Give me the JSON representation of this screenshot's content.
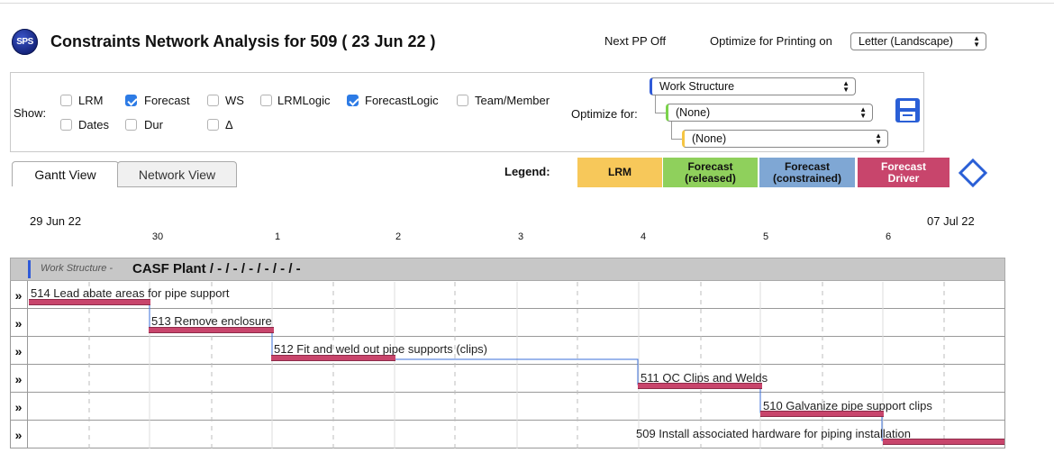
{
  "header": {
    "logo_text": "SPS",
    "title": "Constraints Network Analysis for 509 ( 23 Jun 22 )",
    "next_pp": "Next PP Off",
    "optimize_printing_label": "Optimize for Printing on",
    "print_option": "Letter (Landscape)"
  },
  "options": {
    "show_label": "Show:",
    "checkboxes": [
      {
        "label": "LRM",
        "checked": false
      },
      {
        "label": "Forecast",
        "checked": true
      },
      {
        "label": "WS",
        "checked": false
      },
      {
        "label": "LRMLogic",
        "checked": false
      },
      {
        "label": "ForecastLogic",
        "checked": true
      },
      {
        "label": "Team/Member",
        "checked": false
      },
      {
        "label": "Dates",
        "checked": false
      },
      {
        "label": "Dur",
        "checked": false
      },
      {
        "label": "Δ",
        "checked": false
      }
    ],
    "optimize_for_label": "Optimize for:",
    "level1": "Work Structure",
    "level2": "(None)",
    "level3": "(None)",
    "accent_level1": "#2f5ad8",
    "accent_level2": "#7bd34b",
    "accent_level3": "#f5c542"
  },
  "tabs": [
    {
      "label": "Gantt View",
      "active": true
    },
    {
      "label": "Network View",
      "active": false
    }
  ],
  "legend": {
    "label": "Legend:",
    "items": [
      {
        "label": "LRM",
        "color": "#f7c85a"
      },
      {
        "label": "Forecast (released)",
        "line1": "Forecast",
        "line2": "(released)",
        "color": "#8fd05c"
      },
      {
        "label": "Forecast (constrained)",
        "line1": "Forecast",
        "line2": "(constrained)",
        "color": "#7fa7d4"
      },
      {
        "label": "Forecast Driver",
        "line1": "Forecast",
        "line2": "Driver",
        "color": "#c8456c"
      }
    ]
  },
  "timeline": {
    "start_date": "29 Jun 22",
    "end_date": "07 Jul 22",
    "day_ticks": [
      "30",
      "1",
      "2",
      "3",
      "4",
      "5",
      "6"
    ]
  },
  "gantt": {
    "group_prefix": "Work Structure -",
    "group_title": "CASF Plant / - / - / - / - / - / -",
    "expand_symbol": "»",
    "tasks": [
      {
        "label": "514 Lead abate areas for pipe support"
      },
      {
        "label": "513 Remove enclosure"
      },
      {
        "label": "512 Fit and weld out pipe supports (clips)"
      },
      {
        "label": "511 QC Clips and Welds"
      },
      {
        "label": "510 Galvanize pipe support clips"
      },
      {
        "label": "509 Install associated hardware for piping installation"
      }
    ]
  }
}
